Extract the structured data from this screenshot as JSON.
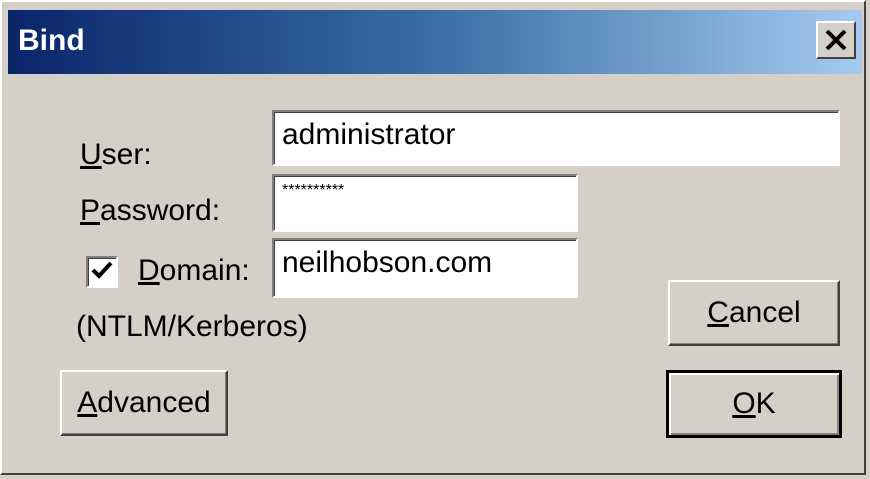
{
  "window": {
    "title": "Bind",
    "close_icon": "close-icon"
  },
  "form": {
    "user_label_accel": "U",
    "user_label_rest": "ser:",
    "user_value": "administrator",
    "password_label_accel": "P",
    "password_label_rest": "assword:",
    "password_value": "**********",
    "domain_checked": true,
    "domain_label_accel": "D",
    "domain_label_rest": "omain:",
    "domain_value": "neilhobson.com",
    "auth_note": "(NTLM/Kerberos)"
  },
  "buttons": {
    "cancel_accel": "C",
    "cancel_rest": "ancel",
    "ok_accel": "O",
    "ok_rest": "K",
    "advanced_accel": "A",
    "advanced_rest": "dvanced"
  },
  "colors": {
    "dialog_face": "#d4d0c8",
    "title_gradient_start": "#0a246a",
    "title_gradient_end": "#a6caf0",
    "title_text": "#ffffff"
  }
}
